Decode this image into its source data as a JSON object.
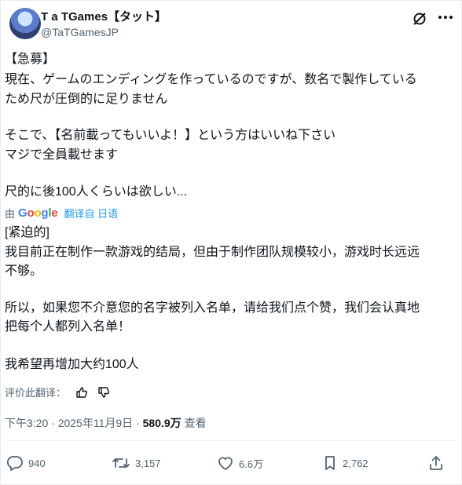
{
  "author": {
    "display_name": "T a TGames【タット】",
    "handle": "@TaTGamesJP"
  },
  "icons": {
    "grok": "grok-icon",
    "more": "more-horizontal-icon",
    "like": "thumbs-up-icon",
    "dislike": "thumbs-down-icon",
    "reply": "reply-icon",
    "retweet": "retweet-icon",
    "heart": "heart-icon",
    "bookmark": "bookmark-icon",
    "share": "share-icon"
  },
  "tweet": {
    "lines": [
      "【急募】",
      "現在、ゲームのエンディングを作っているのですが、数名で製作している",
      "ため尺が圧倒的に足りません",
      "",
      "そこで、【名前載ってもいいよ！】という方はいいね下さい",
      "マジで全員載せます",
      "",
      "尺的に後100人くらいは欲しい..."
    ]
  },
  "translation": {
    "by_prefix": "由",
    "google": "Google",
    "link_text": "翻译自 日语",
    "lines": [
      "[紧迫的]",
      "我目前正在制作一款游戏的结局，但由于制作团队规模较小，游戏时长远远",
      "不够。",
      "",
      "所以，如果您不介意您的名字被列入名单，请给我们点个赞，我们会认真地",
      "把每个人都列入名单！",
      "",
      "我希望再增加大约100人"
    ],
    "rate_label": "评价此翻译："
  },
  "meta": {
    "time": "下午3:20",
    "sep1": "·",
    "date": "2025年11月9日",
    "sep2": "·",
    "views": "580.9万",
    "views_label": "查看"
  },
  "actions": {
    "replies": "940",
    "retweets": "3,157",
    "likes": "6.6万",
    "bookmarks": "2,762"
  },
  "colors": {
    "text": "#0f1419",
    "secondary": "#536471",
    "link": "#1d9bf0",
    "divider": "#eff3f4"
  }
}
